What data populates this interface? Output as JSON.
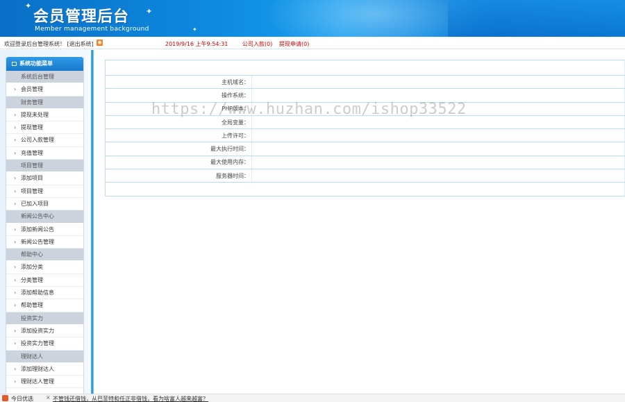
{
  "header": {
    "title": "会员管理后台",
    "subtitle": "Member management background"
  },
  "statusbar": {
    "welcome": "欢迎登录后台管理系统！",
    "logout": "[退出系统]",
    "datetime": "2019/9/16 上午9:54:31",
    "company_income": "公司入款(0)",
    "withdraw_request": "提现申请(0)"
  },
  "sidebar": {
    "title": "系统功能菜单",
    "groups": [
      {
        "head": "系统后台管理",
        "items": [
          "会员管理"
        ]
      },
      {
        "head": "财务管理",
        "items": [
          "提现未处理",
          "提现管理",
          "公司入款管理",
          "充值管理"
        ]
      },
      {
        "head": "项目管理",
        "items": [
          "添加项目",
          "项目管理",
          "已加入项目"
        ]
      },
      {
        "head": "新闻公告中心",
        "items": [
          "添加新闻公告",
          "新闻公告管理"
        ]
      },
      {
        "head": "帮助中心",
        "items": [
          "添加分类",
          "分类管理",
          "添加帮助信息",
          "帮助管理"
        ]
      },
      {
        "head": "投资实力",
        "items": [
          "添加投资实力",
          "投资实力管理"
        ]
      },
      {
        "head": "理财达人",
        "items": [
          "添加理财达人",
          "理财达人管理"
        ]
      }
    ]
  },
  "server_info": {
    "rows": [
      {
        "label": "主机域名：",
        "value": ""
      },
      {
        "label": "操作系统：",
        "value": ""
      },
      {
        "label": "PHP版本：",
        "value": ""
      },
      {
        "label": "全局变量：",
        "value": ""
      },
      {
        "label": "上传许可：",
        "value": ""
      },
      {
        "label": "最大执行时间：",
        "value": ""
      },
      {
        "label": "最大使用内存：",
        "value": ""
      },
      {
        "label": "服务器时间：",
        "value": ""
      }
    ]
  },
  "watermark": "https://www.huzhan.com/ishop33522",
  "taskbar": {
    "today": "今日优选",
    "news": "不管钱还借钱，从巴菲特和任正非借钱，看为啥富人越来越富？"
  },
  "colors": {
    "header_blue": "#0d8be0",
    "accent_red": "#d40000",
    "menu_title_blue": "#1677c9",
    "group_head_gray": "#ccd3dc"
  }
}
